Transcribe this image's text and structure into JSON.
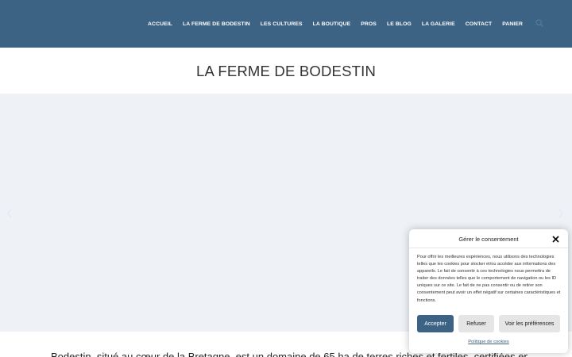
{
  "header": {
    "nav": [
      {
        "label": "ACCUEIL"
      },
      {
        "label": "LA FERME DE BODESTIN"
      },
      {
        "label": "LES CULTURES"
      },
      {
        "label": "LA BOUTIQUE"
      },
      {
        "label": "PROS"
      },
      {
        "label": "LE BLOG"
      },
      {
        "label": "LA GALERIE"
      },
      {
        "label": "CONTACT"
      },
      {
        "label": "PANIER"
      }
    ],
    "search_icon": "search-icon"
  },
  "page": {
    "title": "LA FERME DE BODESTIN",
    "intro": "Bodestin, situé au cœur de la Bretagne, est un domaine de 65 ha de terres riches et fertiles, certifiées en"
  },
  "consent": {
    "title": "Gérer le consentement",
    "body": "Pour offrir les meilleures expériences, nous utilisons des technologies telles que les cookies pour stocker et/ou accéder aux informations des appareils. Le fait de consentir à ces technologies nous permettra de traiter des données telles que le comportement de navigation ou les ID uniques sur ce site. Le fait de ne pas consentir ou de retirer son consentement peut avoir un effet négatif sur certaines caractéristiques et fonctions.",
    "accept": "Accepter",
    "refuse": "Refuser",
    "preferences": "Voir les préférences",
    "policy_link": "Politique de cookies"
  },
  "colors": {
    "header_bg": "#3d6384",
    "accent": "#3d6384"
  }
}
